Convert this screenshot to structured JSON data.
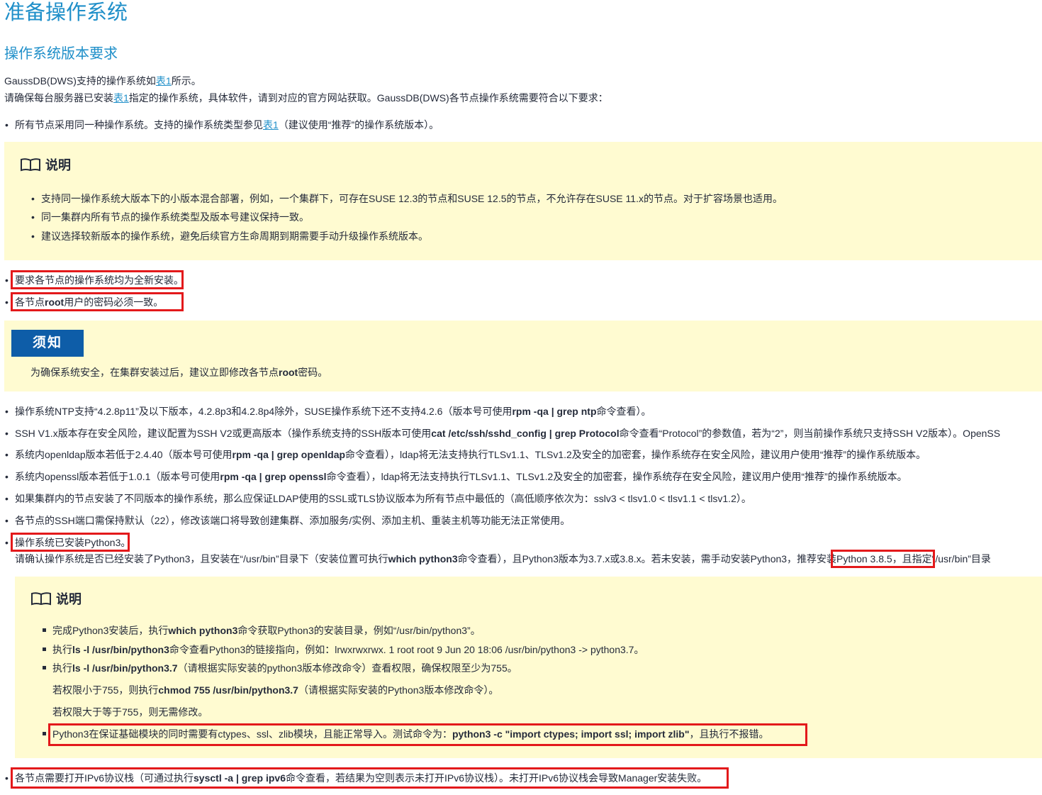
{
  "page": {
    "title": "准备操作系统",
    "section_title": "操作系统版本要求"
  },
  "intro": {
    "line1_pre": "GaussDB(DWS)支持的操作系统如",
    "line1_link": "表1",
    "line1_post": "所示。",
    "line2_pre": "请确保每台服务器已安装",
    "line2_link": "表1",
    "line2_post": "指定的操作系统，具体软件，请到对应的官方网站获取。GaussDB(DWS)各节点操作系统需要符合以下要求："
  },
  "req1": {
    "pre": "所有节点采用同一种操作系统。支持的操作系统类型参见",
    "link": "表1",
    "post": "（建议使用“推荐”的操作系统版本）。"
  },
  "note1": {
    "title": "说明",
    "items": [
      "支持同一操作系统大版本下的小版本混合部署，例如，一个集群下，可存在SUSE 12.3的节点和SUSE 12.5的节点，不允许存在SUSE 11.x的节点。对于扩容场景也适用。",
      "同一集群内所有节点的操作系统类型及版本号建议保持一致。",
      "建议选择较新版本的操作系统，避免后续官方生命周期到期需要手动升级操作系统版本。"
    ]
  },
  "req2": "要求各节点的操作系统均为全新安装。",
  "req3": {
    "pre": "各节点",
    "bold": "root",
    "post": "用户的密码必须一致。"
  },
  "notice": {
    "label": "须知",
    "text_pre": "为确保系统安全，在集群安装过后，建议立即修改各节点",
    "text_bold": "root",
    "text_post": "密码。"
  },
  "req_ntp": {
    "pre": "操作系统NTP支持“4.2.8p11”及以下版本，4.2.8p3和4.2.8p4除外，SUSE操作系统下还不支持4.2.6（版本号可使用",
    "cmd": "rpm -qa | grep ntp",
    "post": "命令查看）。"
  },
  "req_ssh": {
    "pre": "SSH V1.x版本存在安全风险，建议配置为SSH V2或更高版本（操作系统支持的SSH版本可使用",
    "cmd": "cat /etc/ssh/sshd_config | grep Protocol",
    "post": "命令查看“Protocol”的参数值，若为“2”，则当前操作系统只支持SSH V2版本）。OpenSS"
  },
  "req_ldap": {
    "pre": "系统内openldap版本若低于2.4.40（版本号可使用",
    "cmd": "rpm -qa | grep openldap",
    "post": "命令查看），ldap将无法支持执行TLSv1.1、TLSv1.2及安全的加密套，操作系统存在安全风险，建议用户使用“推荐”的操作系统版本。"
  },
  "req_ssl": {
    "pre": "系统内openssl版本若低于1.0.1（版本号可使用",
    "cmd": "rpm -qa | grep openssl",
    "post": "命令查看），ldap将无法支持执行TLSv1.1、TLSv1.2及安全的加密套，操作系统存在安全风险，建议用户使用“推荐”的操作系统版本。"
  },
  "req_tls": "如果集群内的节点安装了不同版本的操作系统，那么应保证LDAP使用的SSL或TLS协议版本为所有节点中最低的（高低顺序依次为：sslv3 < tlsv1.0 < tlsv1.1 < tlsv1.2）。",
  "req_port": "各节点的SSH端口需保持默认（22），修改该端口将导致创建集群、添加服务/实例、添加主机、重装主机等功能无法正常使用。",
  "req_python": {
    "title": "操作系统已安装Python3。",
    "detail_pre": "请确认操作系统是否已经安装了Python3，且安装在“/usr/bin”目录下（安装位置可执行",
    "detail_cmd": "which python3",
    "detail_mid": "命令查看），且Python3版本为3.7.x或3.8.x。若未安装，需手动安装Python3，",
    "detail_highlight": "推荐安装Python 3.8.5",
    "detail_post": "，且指定“/usr/bin”目录"
  },
  "note2": {
    "title": "说明",
    "item1_pre": "完成Python3安装后，执行",
    "item1_cmd": "which python3",
    "item1_post": "命令获取Python3的安装目录，例如“/usr/bin/python3”。",
    "item2_pre": "执行",
    "item2_cmd": "ls -l /usr/bin/python3",
    "item2_post": "命令查看Python3的链接指向，例如：lrwxrwxrwx. 1 root root 9 Jun 20 18:06 /usr/bin/python3 -> python3.7。",
    "item3_pre": "执行",
    "item3_cmd": "ls -l /usr/bin/python3.7",
    "item3_post": "（请根据实际安装的python3版本修改命令）查看权限，确保权限至少为755。",
    "item3_sub1_pre": "若权限小于755，则执行",
    "item3_sub1_cmd": "chmod 755 /usr/bin/python3.7",
    "item3_sub1_post": "（请根据实际安装的Python3版本修改命令）。",
    "item3_sub2": "若权限大于等于755，则无需修改。",
    "item4_pre": "Python3在保证基础模块的同时需要有ctypes、ssl、zlib模块，且能正常导入。测试命令为：",
    "item4_cmd": "python3 -c \"import ctypes; import ssl; import zlib\"",
    "item4_post": "，且执行不报错。"
  },
  "req_ipv6": {
    "pre": "各节点需要打开IPv6协议栈（可通过执行",
    "cmd": "sysctl -a | grep ipv6",
    "post": "命令查看，若结果为空则表示未打开IPv6协议栈）。未打开IPv6协议栈会导致Manager安装失败。"
  },
  "colors": {
    "heading": "#1f8fc9",
    "link": "#1f8fc9",
    "note_bg": "#fffbd1",
    "notice_label_bg": "#0e5da8",
    "highlight_box": "#e3191b",
    "text": "#252b3a"
  }
}
